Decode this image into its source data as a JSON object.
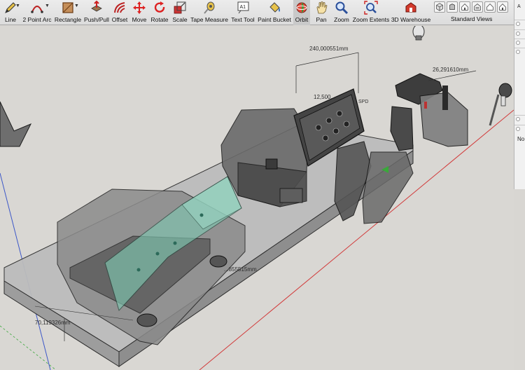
{
  "toolbar": {
    "tools": [
      {
        "name": "line",
        "label": "Line",
        "icon": "pencil-icon"
      },
      {
        "name": "two-point-arc",
        "label": "2 Point Arc",
        "icon": "arc-icon"
      },
      {
        "name": "rectangle",
        "label": "Rectangle",
        "icon": "rectangle-icon"
      },
      {
        "name": "push-pull",
        "label": "Push/Pull",
        "icon": "push-pull-icon"
      },
      {
        "name": "offset",
        "label": "Offset",
        "icon": "offset-icon"
      },
      {
        "name": "move",
        "label": "Move",
        "icon": "move-icon"
      },
      {
        "name": "rotate",
        "label": "Rotate",
        "icon": "rotate-icon"
      },
      {
        "name": "scale",
        "label": "Scale",
        "icon": "scale-icon"
      },
      {
        "name": "tape-measure",
        "label": "Tape Measure",
        "icon": "tape-measure-icon"
      },
      {
        "name": "text-tool",
        "label": "Text Tool",
        "icon": "text-icon",
        "icon_text": "A1"
      },
      {
        "name": "paint-bucket",
        "label": "Paint Bucket",
        "icon": "paint-bucket-icon"
      },
      {
        "name": "orbit",
        "label": "Orbit",
        "icon": "orbit-icon"
      },
      {
        "name": "pan",
        "label": "Pan",
        "icon": "hand-icon"
      },
      {
        "name": "zoom",
        "label": "Zoom",
        "icon": "magnifier-icon"
      },
      {
        "name": "zoom-extents",
        "label": "Zoom Extents",
        "icon": "zoom-extents-icon"
      },
      {
        "name": "3d-warehouse",
        "label": "3D Warehouse",
        "icon": "warehouse-icon"
      }
    ],
    "active_tool": "Orbit",
    "standard_views_label": "Standard Views"
  },
  "viewport": {
    "dimensions": [
      {
        "name": "dimension-length",
        "value": "240,000551mm"
      },
      {
        "name": "dimension-right",
        "value": "26,291610mm"
      },
      {
        "name": "dimension-small",
        "value": "12,500..."
      },
      {
        "name": "dimension-base",
        "value": "...855515mm"
      },
      {
        "name": "dimension-depth",
        "value": "70,119326mm"
      }
    ],
    "panel_label": "SPD"
  },
  "tray": {
    "top_label": "A",
    "label": "No"
  },
  "colors": {
    "glass": "#7fc6b0",
    "axis_red": "#d23a3a",
    "axis_green": "#3aa83a",
    "axis_blue": "#3c57c8"
  }
}
